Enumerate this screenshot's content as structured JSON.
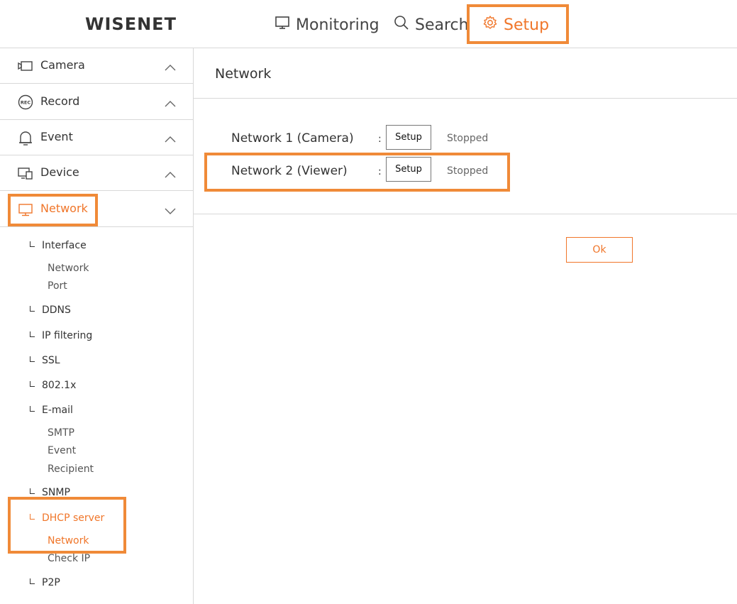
{
  "header": {
    "logo": "WISENET",
    "nav": {
      "monitoring": "Monitoring",
      "search": "Search",
      "setup": "Setup"
    }
  },
  "sidebar": {
    "menus": [
      {
        "label": "Camera",
        "icon": "camera-icon"
      },
      {
        "label": "Record",
        "icon": "rec-icon",
        "badge": "REC"
      },
      {
        "label": "Event",
        "icon": "bell-icon"
      },
      {
        "label": "Device",
        "icon": "device-icon"
      },
      {
        "label": "Network",
        "icon": "monitor-icon"
      }
    ],
    "network_tree": {
      "interface": "Interface",
      "interface_network": "Network",
      "interface_port": "Port",
      "ddns": "DDNS",
      "ip_filtering": "IP filtering",
      "ssl": "SSL",
      "dot1x": "802.1x",
      "email": "E-mail",
      "email_smtp": "SMTP",
      "email_event": "Event",
      "email_recipient": "Recipient",
      "snmp": "SNMP",
      "dhcp_server": "DHCP server",
      "dhcp_network": "Network",
      "dhcp_check_ip": "Check IP",
      "p2p": "P2P"
    }
  },
  "main": {
    "title": "Network",
    "rows": [
      {
        "label": "Network 1 (Camera)",
        "colon": ":",
        "button": "Setup",
        "status": "Stopped"
      },
      {
        "label": "Network 2 (Viewer)",
        "colon": ":",
        "button": "Setup",
        "status": "Stopped"
      }
    ],
    "ok_label": "Ok"
  },
  "colors": {
    "accent": "#f0762a",
    "highlight_box": "#f08a38",
    "divider": "#d8d8d8"
  }
}
